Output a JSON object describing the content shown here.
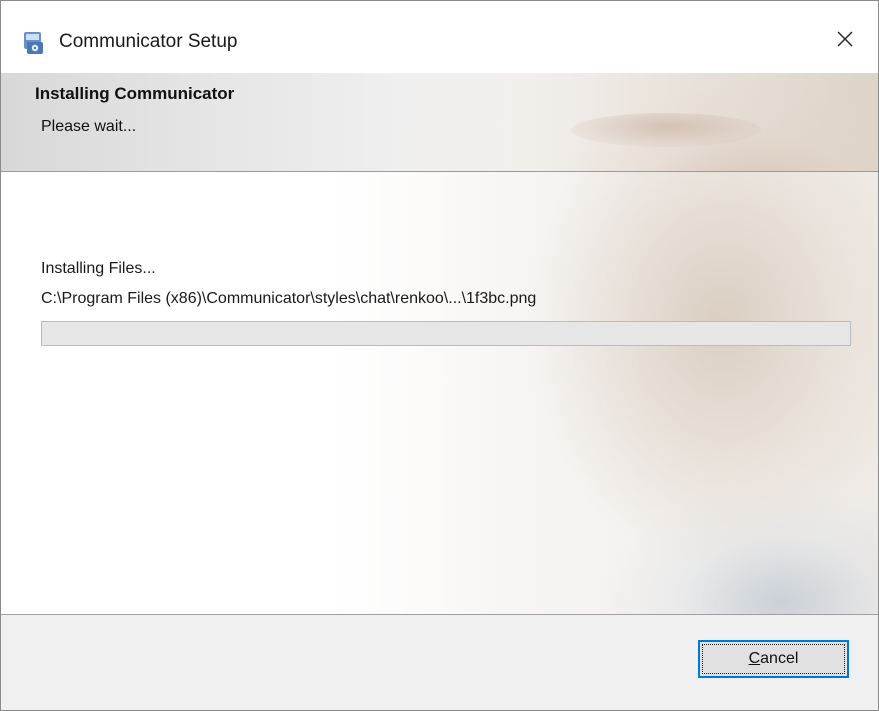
{
  "window": {
    "title": "Communicator Setup",
    "icon": "setup-app-icon",
    "close_icon": "close-icon"
  },
  "header": {
    "title": "Installing Communicator",
    "subtitle": "Please wait..."
  },
  "progress": {
    "status": "Installing Files...",
    "current_file": "C:\\Program Files (x86)\\Communicator\\styles\\chat\\renkoo\\...\\1f3bc.png",
    "fraction": 0.0
  },
  "footer": {
    "cancel_mnemonic": "C",
    "cancel_rest": "ancel"
  },
  "colors": {
    "accent": "#0078d7",
    "footer_bg": "#f0f0f0",
    "progress_track": "#e6e6e6"
  }
}
